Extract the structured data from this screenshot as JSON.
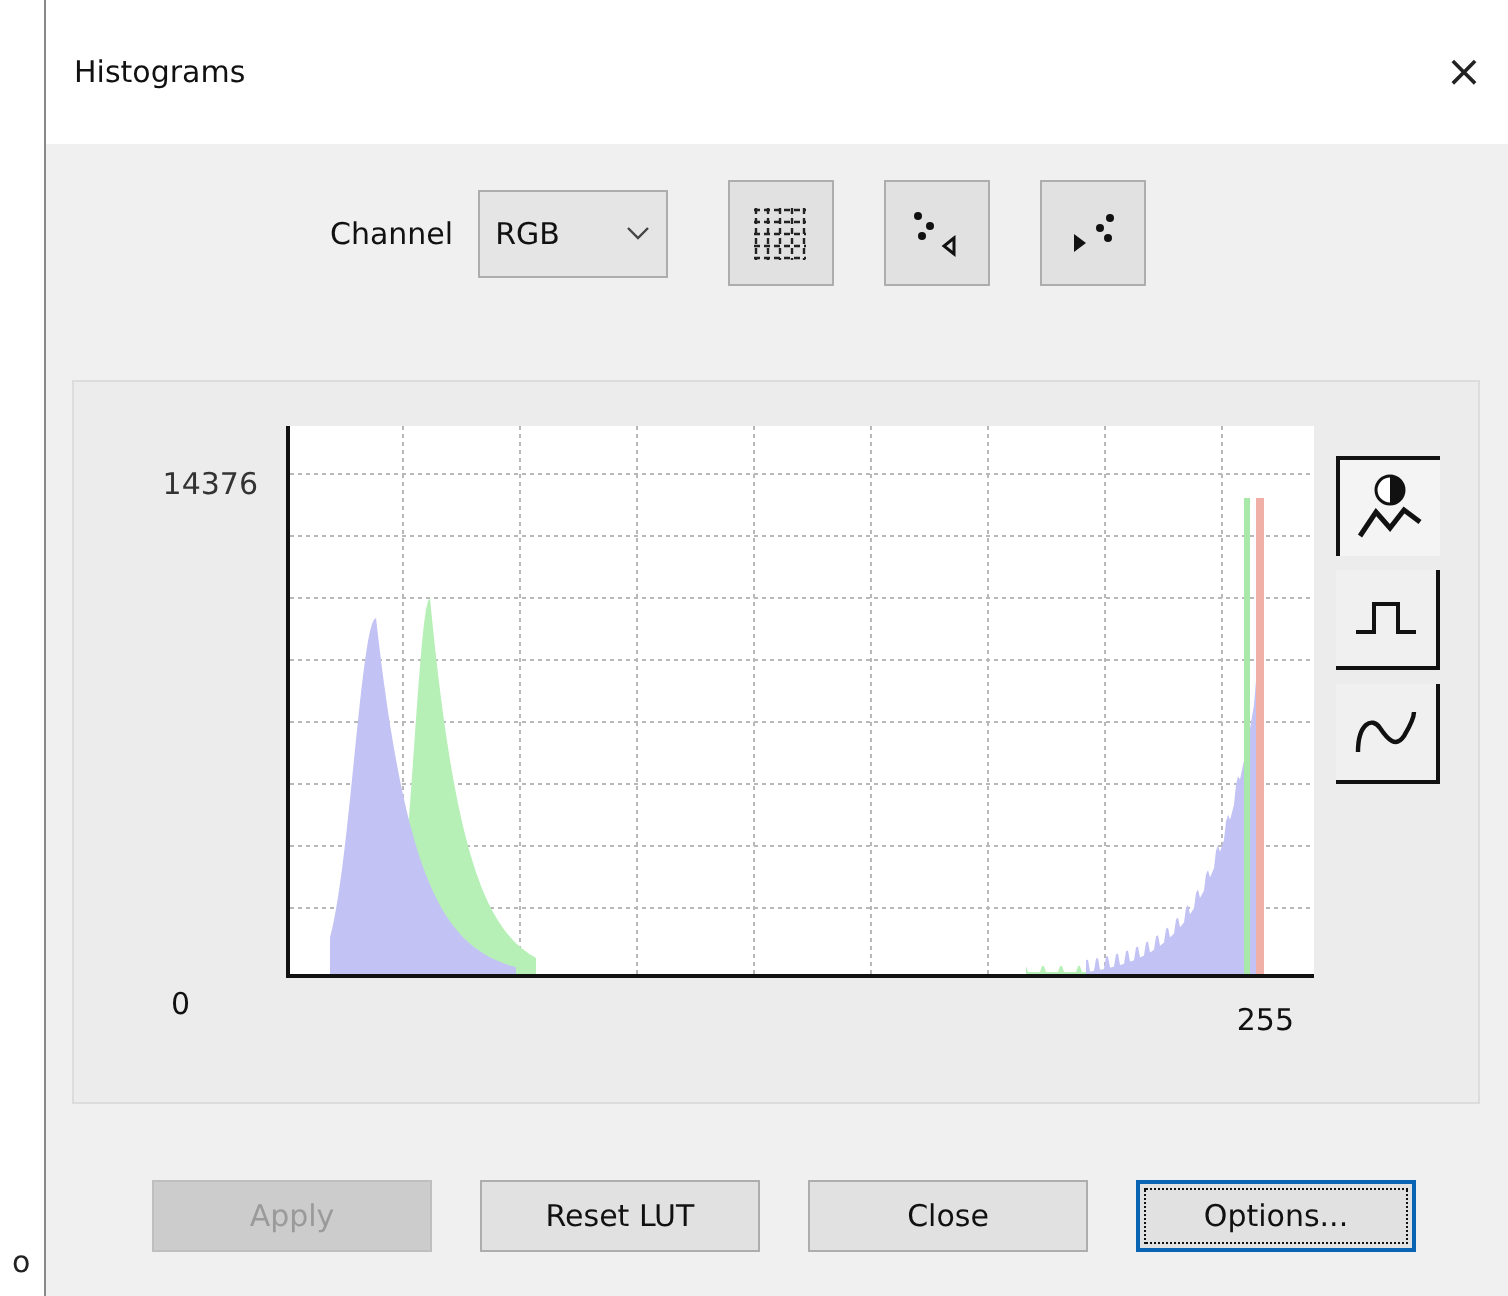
{
  "window": {
    "title": "Histograms",
    "close": "×"
  },
  "channel": {
    "label": "Channel",
    "value": "RGB"
  },
  "view_buttons": [
    {
      "kind": "grid"
    },
    {
      "kind": "dots-left"
    },
    {
      "kind": "dots-right"
    }
  ],
  "histogram": {
    "y_max": "14376",
    "y_min": "0",
    "x_max": "255"
  },
  "mode_buttons": [
    {
      "kind": "curve",
      "selected": true
    },
    {
      "kind": "step",
      "selected": false
    },
    {
      "kind": "wave",
      "selected": false
    }
  ],
  "buttons": [
    {
      "label": "Apply",
      "disabled": true,
      "focused": false
    },
    {
      "label": "Reset LUT",
      "disabled": false,
      "focused": false
    },
    {
      "label": "Close",
      "disabled": false,
      "focused": false
    },
    {
      "label": "Options...",
      "disabled": false,
      "focused": true
    }
  ],
  "stray_mark": "o"
}
